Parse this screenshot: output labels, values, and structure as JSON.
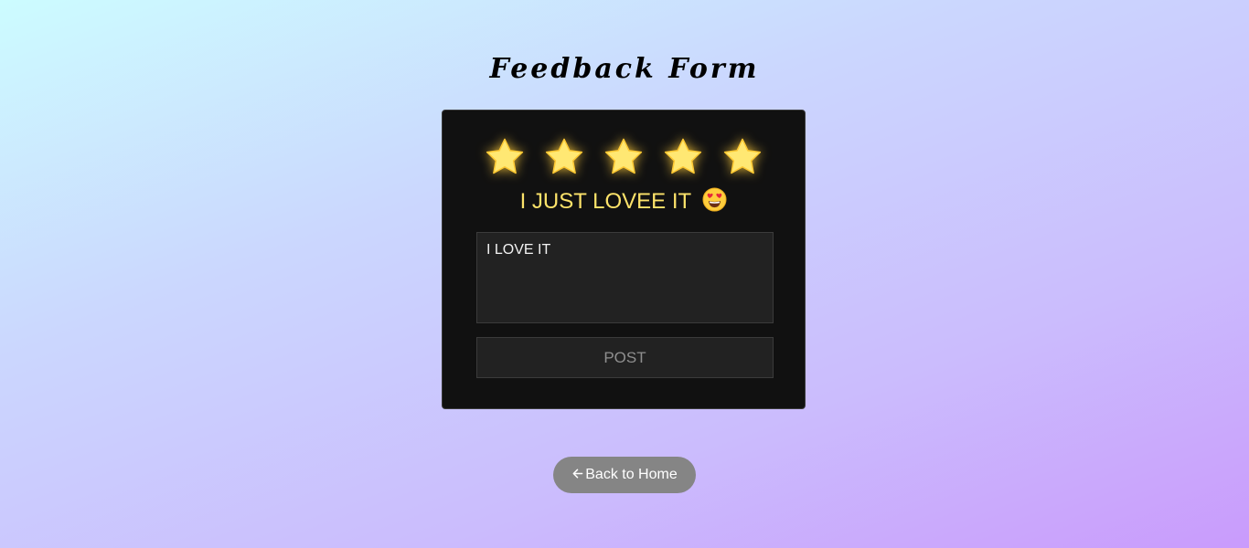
{
  "page": {
    "title": "Feedback Form"
  },
  "rating": {
    "value": 5,
    "max": 5,
    "label": "I JUST LOVEE IT",
    "emoji": "heart-eyes-emoji",
    "star_color": "#ffe06a",
    "label_color": "#fde36a"
  },
  "feedback": {
    "text": "I LOVE IT"
  },
  "post_button": {
    "label": "POST"
  },
  "back_button": {
    "label": "Back to Home",
    "icon": "arrow-left-icon"
  }
}
